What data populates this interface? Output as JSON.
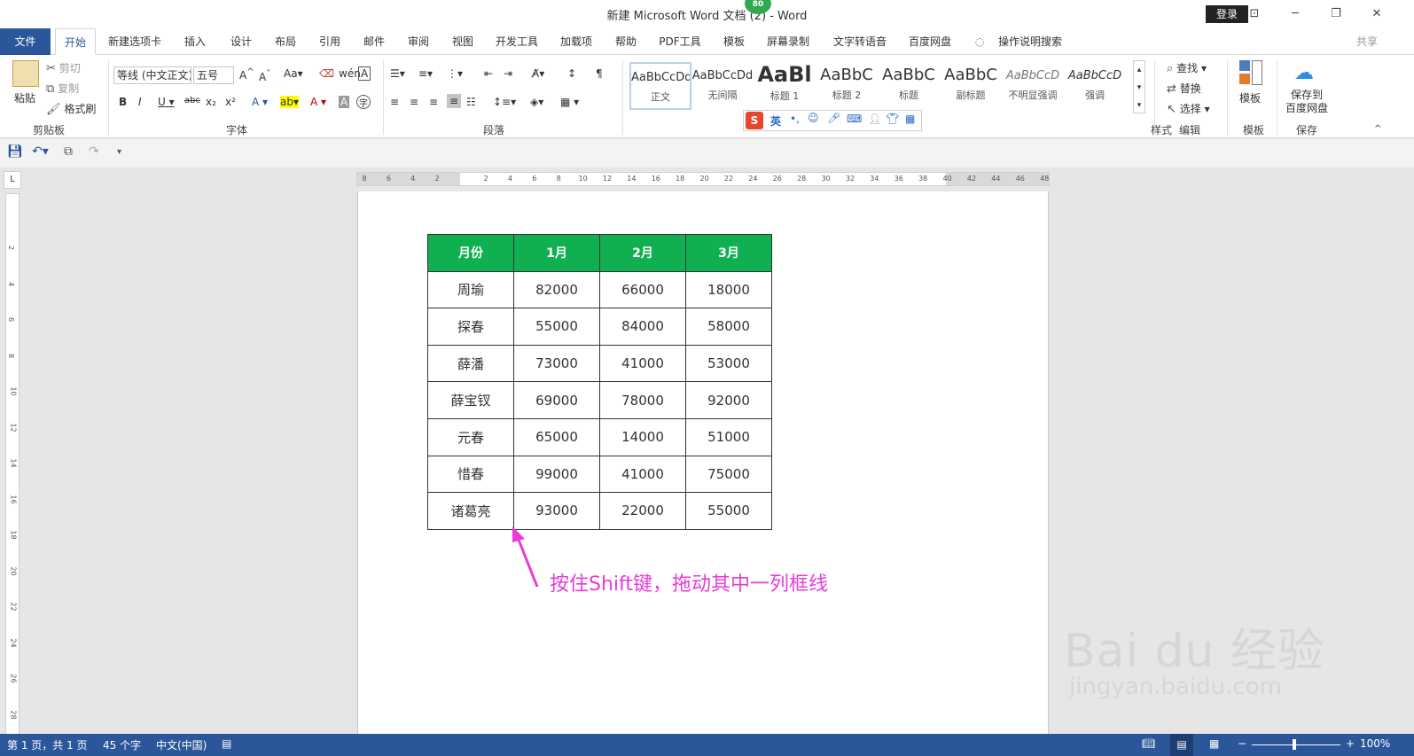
{
  "window": {
    "title": "新建 Microsoft Word 文档 (2) - Word",
    "login_label": "登录",
    "badge": "80",
    "controls": [
      "⊡",
      "─",
      "❐",
      "✕"
    ]
  },
  "tabs": [
    {
      "label": "文件"
    },
    {
      "label": "开始"
    },
    {
      "label": "新建选项卡"
    },
    {
      "label": "插入"
    },
    {
      "label": "设计"
    },
    {
      "label": "布局"
    },
    {
      "label": "引用"
    },
    {
      "label": "邮件"
    },
    {
      "label": "审阅"
    },
    {
      "label": "视图"
    },
    {
      "label": "开发工具"
    },
    {
      "label": "加载项"
    },
    {
      "label": "帮助"
    },
    {
      "label": "PDF工具"
    },
    {
      "label": "模板"
    },
    {
      "label": "屏幕录制"
    },
    {
      "label": "文字转语音"
    },
    {
      "label": "百度网盘"
    },
    {
      "label": "操作说明搜索"
    }
  ],
  "share_label": "共享",
  "ribbon": {
    "clipboard": {
      "paste": "粘贴",
      "cut": "剪切",
      "copy": "复制",
      "format_painter": "格式刷",
      "label": "剪贴板"
    },
    "font": {
      "font_name": "等线 (中文正文)",
      "font_size": "五号",
      "label": "字体"
    },
    "paragraph": {
      "label": "段落"
    },
    "styles": {
      "items": [
        {
          "sample": "AaBbCcDd",
          "name": "正文"
        },
        {
          "sample": "AaBbCcDd",
          "name": "无间隔"
        },
        {
          "sample": "AaBl",
          "name": "标题 1"
        },
        {
          "sample": "AaBbC",
          "name": "标题 2"
        },
        {
          "sample": "AaBbC",
          "name": "标题"
        },
        {
          "sample": "AaBbC",
          "name": "副标题"
        },
        {
          "sample": "AaBbCcD",
          "name": "不明显强调"
        },
        {
          "sample": "AaBbCcD",
          "name": "强调"
        }
      ],
      "label": "样式"
    },
    "editing": {
      "find": "查找",
      "replace": "替换",
      "select": "选择",
      "label": "编辑"
    },
    "template": {
      "button": "模板",
      "label": "模板"
    },
    "save": {
      "button": "保存到\n百度网盘",
      "label": "保存"
    }
  },
  "ime": {
    "lang": "英"
  },
  "ruler": {
    "h_numbers": [
      "8",
      "6",
      "4",
      "2",
      "",
      "2",
      "4",
      "6",
      "8",
      "10",
      "12",
      "14",
      "16",
      "18",
      "20",
      "22",
      "24",
      "26",
      "28",
      "30",
      "32",
      "34",
      "36",
      "38",
      "40",
      "42",
      "44",
      "46",
      "48"
    ],
    "v_numbers": [
      "2",
      "4",
      "6",
      "8",
      "10",
      "12",
      "14",
      "16",
      "18",
      "20",
      "22",
      "24",
      "26",
      "28"
    ]
  },
  "table": {
    "headers": [
      "月份",
      "1月",
      "2月",
      "3月"
    ],
    "rows": [
      [
        "周瑜",
        "82000",
        "66000",
        "18000"
      ],
      [
        "探春",
        "55000",
        "84000",
        "58000"
      ],
      [
        "薛潘",
        "73000",
        "41000",
        "53000"
      ],
      [
        "薛宝钗",
        "69000",
        "78000",
        "92000"
      ],
      [
        "元春",
        "65000",
        "14000",
        "51000"
      ],
      [
        "惜春",
        "99000",
        "41000",
        "75000"
      ],
      [
        "诸葛亮",
        "93000",
        "22000",
        "55000"
      ]
    ]
  },
  "annotation": "按住Shift键，拖动其中一列框线",
  "watermark": {
    "main": "Bai du 经验",
    "sub": "jingyan.baidu.com"
  },
  "status": {
    "page": "第 1 页，共 1 页",
    "words": "45 个字",
    "language": "中文(中国)",
    "zoom": "100%"
  },
  "colors": {
    "accent": "#2b579a",
    "table_header": "#10b050",
    "annotation": "#e83bd9"
  }
}
